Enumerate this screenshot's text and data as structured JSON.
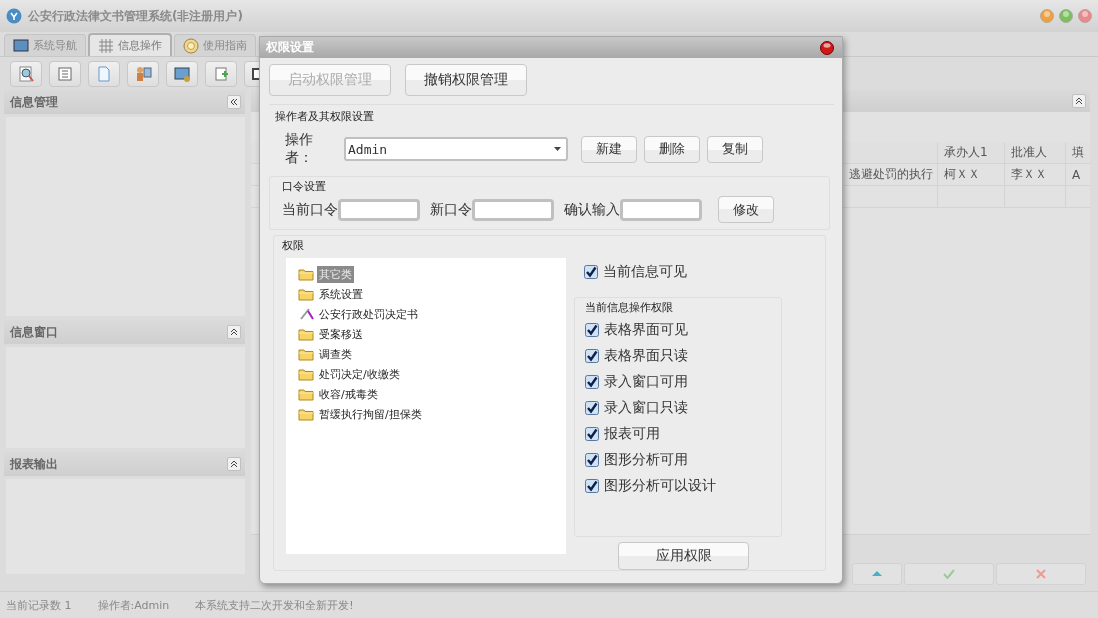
{
  "window": {
    "title": "公安行政法律文书管理系统(非注册用户)"
  },
  "tabs": [
    {
      "label": "系统导航",
      "selected": false
    },
    {
      "label": "信息操作",
      "selected": true
    },
    {
      "label": "使用指南",
      "selected": false
    }
  ],
  "left_panels": [
    {
      "title": "信息管理",
      "expanded": true
    },
    {
      "title": "信息窗口",
      "expanded": false
    },
    {
      "title": "报表输出",
      "expanded": false
    }
  ],
  "table": {
    "columns": [
      "",
      "承办人1",
      "批准人",
      "填"
    ],
    "rows": [
      [
        "逃避处罚的执行",
        "柯ＸＸ",
        "李ＸＸ",
        "A"
      ]
    ]
  },
  "status_bar": [
    "当前记录数 1",
    "操作者:Admin",
    "本系统支持二次开发和全新开发!"
  ],
  "dialog": {
    "title": "权限设置",
    "top_buttons": [
      {
        "label": "启动权限管理",
        "disabled": true
      },
      {
        "label": "撤销权限管理",
        "disabled": false
      }
    ],
    "operator_group": {
      "title": "操作者及其权限设置",
      "label": "操作者：",
      "value": "Admin",
      "buttons": [
        "新建",
        "删除",
        "复制"
      ]
    },
    "password_group": {
      "title": "口令设置",
      "fields": [
        "当前口令",
        "新口令",
        "确认输入"
      ],
      "button": "修改"
    },
    "permissions": {
      "title": "权限",
      "tree": [
        {
          "label": "其它类",
          "kind": "folder",
          "selected": true
        },
        {
          "label": "系统设置",
          "kind": "folder",
          "selected": false
        },
        {
          "label": "公安行政处罚决定书",
          "kind": "document",
          "selected": false
        },
        {
          "label": "受案移送",
          "kind": "folder",
          "selected": false
        },
        {
          "label": "调查类",
          "kind": "folder",
          "selected": false
        },
        {
          "label": "处罚决定/收缴类",
          "kind": "folder",
          "selected": false
        },
        {
          "label": "收容/戒毒类",
          "kind": "folder",
          "selected": false
        },
        {
          "label": "暂缓执行拘留/担保类",
          "kind": "folder",
          "selected": false
        }
      ],
      "visible_checkbox": {
        "label": "当前信息可见",
        "checked": true
      },
      "ops_group": {
        "title": "当前信息操作权限",
        "checkboxes": [
          {
            "label": "表格界面可见",
            "checked": true
          },
          {
            "label": "表格界面只读",
            "checked": true
          },
          {
            "label": "录入窗口可用",
            "checked": true
          },
          {
            "label": "录入窗口只读",
            "checked": true
          },
          {
            "label": "报表可用",
            "checked": true
          },
          {
            "label": "图形分析可用",
            "checked": true
          },
          {
            "label": "图形分析可以设计",
            "checked": true
          }
        ]
      },
      "apply_button": "应用权限"
    }
  }
}
